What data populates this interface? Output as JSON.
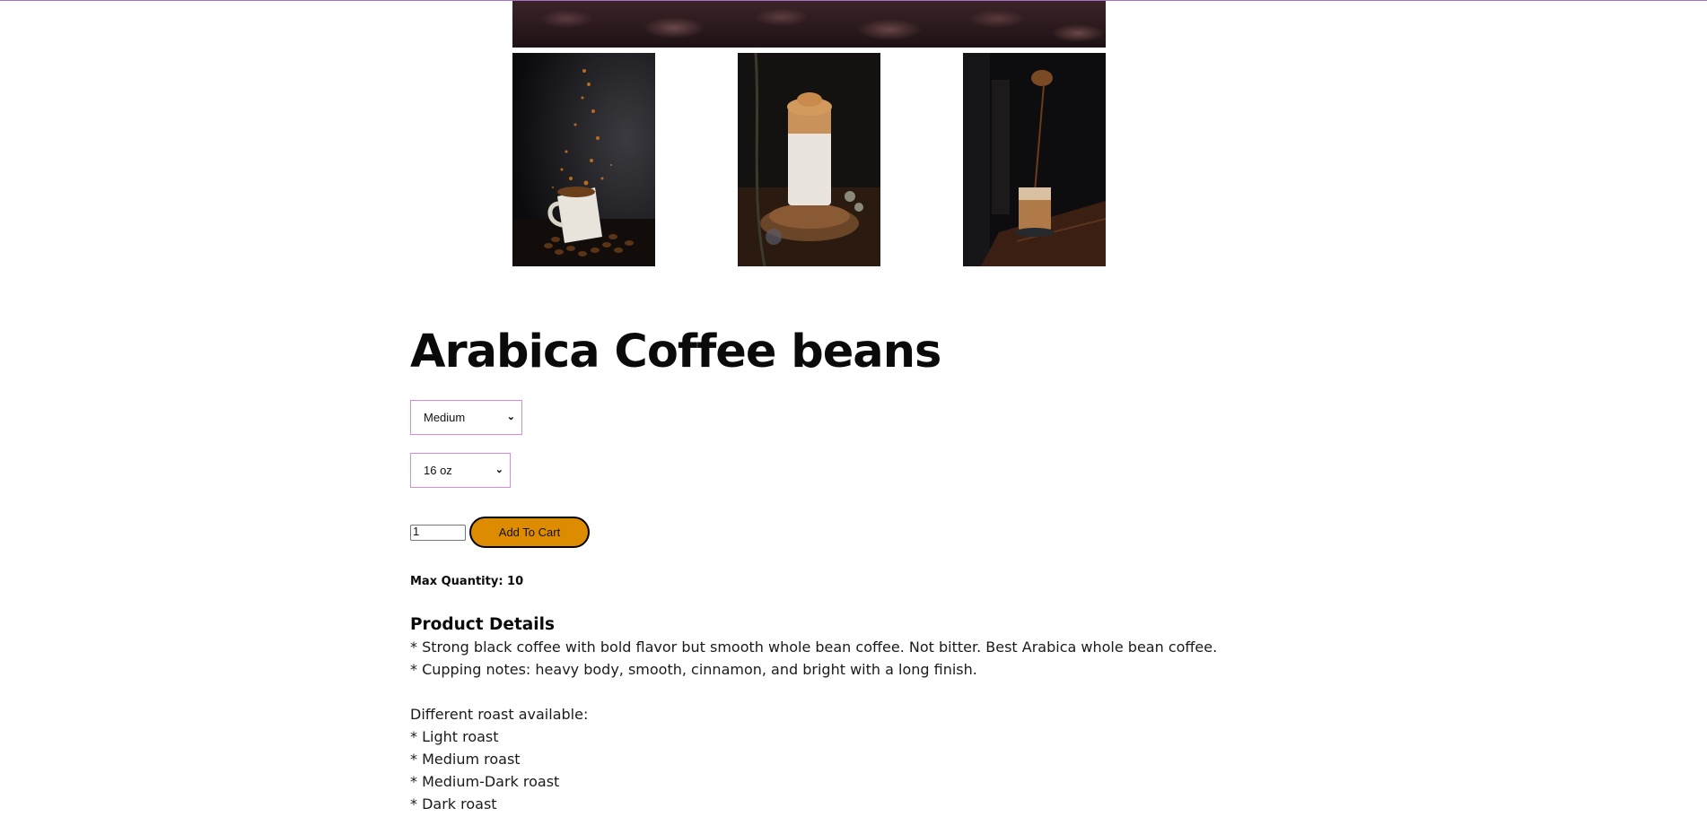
{
  "product": {
    "title": "Arabica Coffee beans",
    "roast_selected": "Medium",
    "size_selected": "16 oz",
    "quantity_value": "1",
    "add_to_cart_label": "Add To Cart",
    "max_quantity_label": "Max Quantity: 10"
  },
  "details": {
    "heading": "Product Details",
    "lines": [
      "* Strong black coffee with bold flavor but smooth whole bean coffee. Not bitter. Best Arabica whole bean coffee.",
      "* Cupping notes: heavy body, smooth, cinnamon, and bright with a long finish."
    ],
    "roast_intro": "Different roast available:",
    "roasts": [
      "* Light roast",
      "* Medium roast",
      "* Medium-Dark roast",
      "* Dark roast"
    ]
  },
  "colors": {
    "accent_border": "#d98ad9",
    "button_fill": "#dd8c00",
    "top_line": "#a572c8"
  },
  "icons": {
    "select_arrow": "chevron-down-icon"
  }
}
